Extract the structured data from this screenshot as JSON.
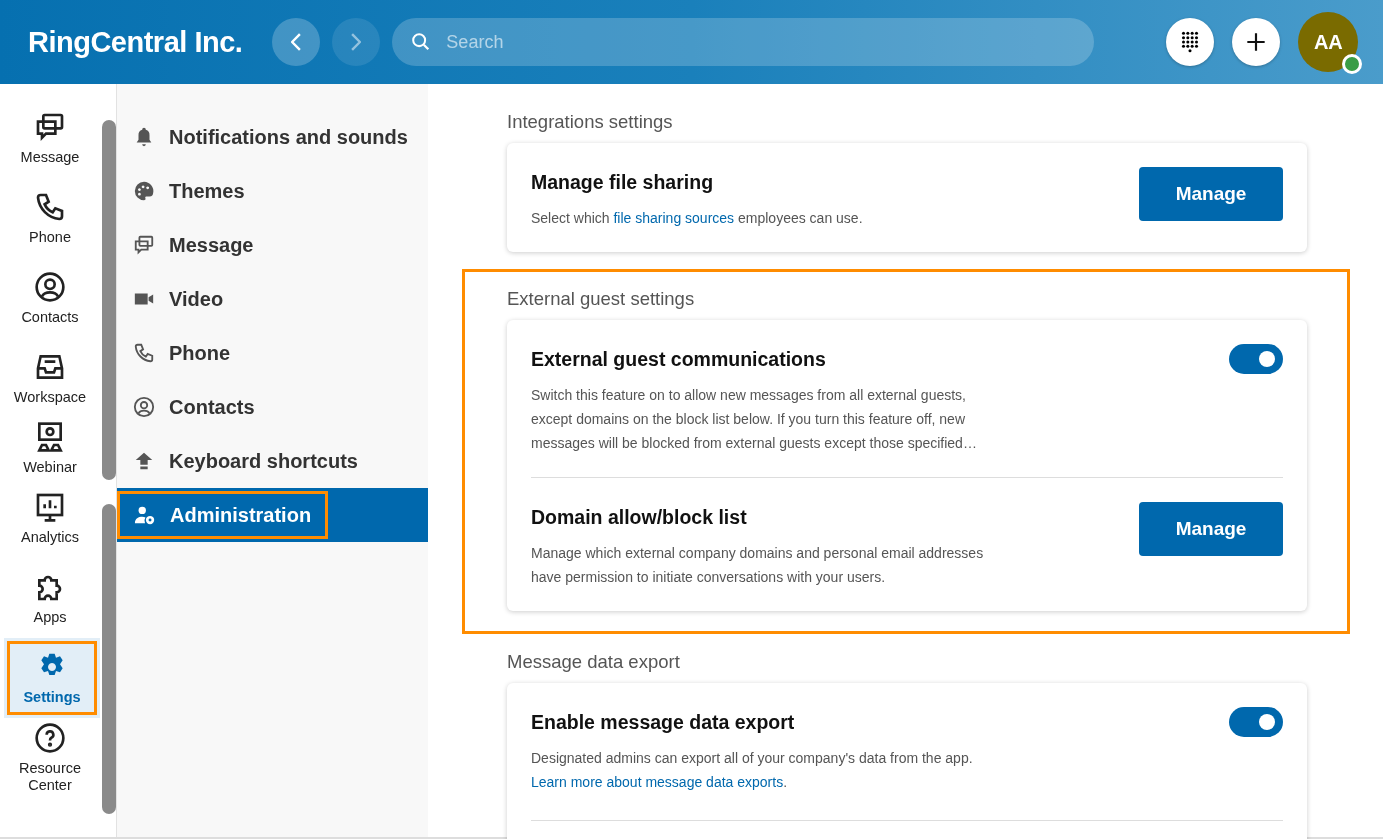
{
  "header": {
    "company": "RingCentral Inc.",
    "search": {
      "placeholder": "Search"
    },
    "avatar": {
      "initials": "AA",
      "online": true
    }
  },
  "rail": [
    {
      "label": "Message",
      "selected": false,
      "highlighted": false
    },
    {
      "label": "Phone",
      "selected": false,
      "highlighted": false
    },
    {
      "label": "Contacts",
      "selected": false,
      "highlighted": false
    },
    {
      "label": "Workspace",
      "selected": false,
      "highlighted": false
    },
    {
      "label": "Webinar",
      "selected": false,
      "highlighted": false
    },
    {
      "label": "Analytics",
      "selected": false,
      "highlighted": false
    },
    {
      "label": "Apps",
      "selected": false,
      "highlighted": false
    },
    {
      "label": "Settings",
      "selected": true,
      "highlighted": true
    },
    {
      "label": "Resource Center",
      "selected": false,
      "highlighted": false
    }
  ],
  "settings_menu": [
    {
      "label": "Notifications and sounds",
      "selected": false,
      "highlighted": false
    },
    {
      "label": "Themes",
      "selected": false,
      "highlighted": false
    },
    {
      "label": "Message",
      "selected": false,
      "highlighted": false
    },
    {
      "label": "Video",
      "selected": false,
      "highlighted": false
    },
    {
      "label": "Phone",
      "selected": false,
      "highlighted": false
    },
    {
      "label": "Contacts",
      "selected": false,
      "highlighted": false
    },
    {
      "label": "Keyboard shortcuts",
      "selected": false,
      "highlighted": false
    },
    {
      "label": "Administration",
      "selected": true,
      "highlighted": true
    }
  ],
  "sections": [
    {
      "title": "Integrations settings",
      "highlighted": false,
      "more_below": false,
      "rows": [
        {
          "title": "Manage file sharing",
          "kind": "button",
          "label": "Manage",
          "description": [
            {
              "kind": "plain",
              "text": "Select which "
            },
            {
              "kind": "link",
              "text": "file sharing sources"
            },
            {
              "kind": "plain",
              "text": " employees can use."
            }
          ]
        }
      ]
    },
    {
      "title": "External guest settings",
      "highlighted": true,
      "more_below": false,
      "rows": [
        {
          "title": "External guest communications",
          "kind": "toggle",
          "on": true,
          "description": [
            {
              "kind": "plain",
              "text": "Switch this feature on to allow new messages from all external guests, except domains on the block list below. If you turn this feature off, new messages will be blocked from external guests except those specified…"
            }
          ]
        },
        {
          "title": "Domain allow/block list",
          "kind": "button",
          "label": "Manage",
          "description": [
            {
              "kind": "plain",
              "text": "Manage which external company domains and personal email addresses have permission to initiate conversations with your users."
            }
          ]
        }
      ]
    },
    {
      "title": "Message data export",
      "highlighted": false,
      "more_below": true,
      "rows": [
        {
          "title": "Enable message data export",
          "kind": "toggle",
          "on": true,
          "description": [
            {
              "kind": "plain",
              "text": "Designated admins can export all of your company's data from the app. "
            },
            {
              "kind": "link",
              "text": "Learn more about message data exports"
            },
            {
              "kind": "plain",
              "text": "."
            }
          ]
        }
      ]
    }
  ]
}
